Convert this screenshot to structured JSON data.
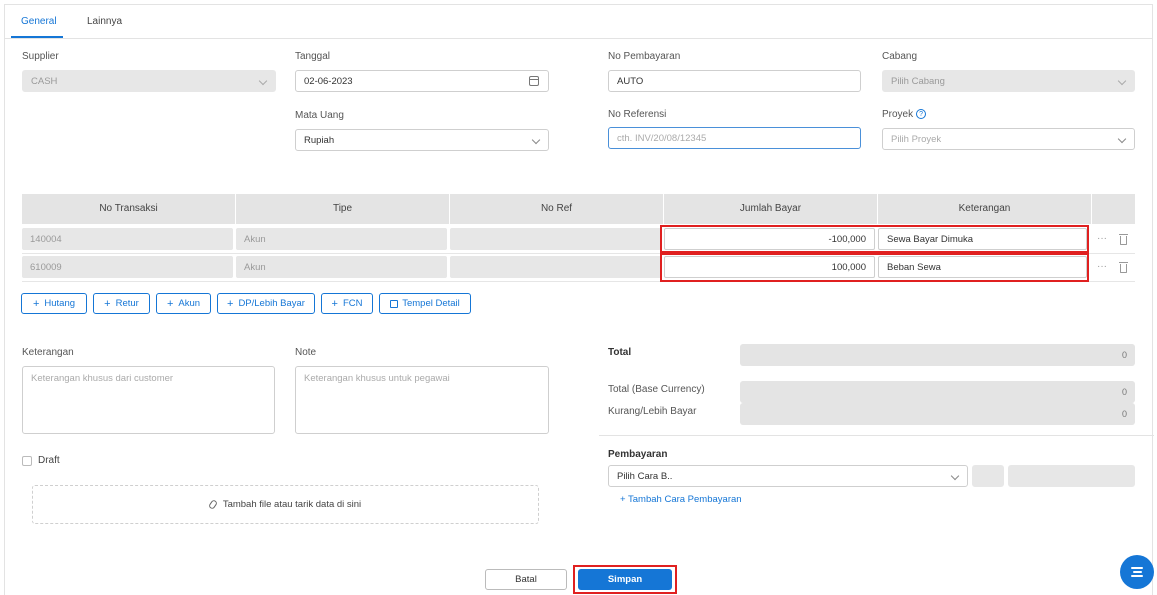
{
  "tabs": [
    {
      "label": "General",
      "active": true
    },
    {
      "label": "Lainnya",
      "active": false
    }
  ],
  "form": {
    "supplier": {
      "label": "Supplier",
      "value": "CASH"
    },
    "tanggal": {
      "label": "Tanggal",
      "value": "02-06-2023"
    },
    "no_pembayaran": {
      "label": "No Pembayaran",
      "value": "AUTO"
    },
    "cabang": {
      "label": "Cabang",
      "placeholder": "Pilih Cabang"
    },
    "mata_uang": {
      "label": "Mata Uang",
      "value": "Rupiah"
    },
    "no_referensi": {
      "label": "No Referensi",
      "placeholder": "cth. INV/20/08/12345"
    },
    "proyek": {
      "label": "Proyek",
      "help": "?",
      "placeholder": "Pilih Proyek"
    }
  },
  "table": {
    "headers": [
      "No Transaksi",
      "Tipe",
      "No Ref",
      "Jumlah Bayar",
      "Keterangan"
    ],
    "rows": [
      {
        "no_transaksi": "140004",
        "tipe": "Akun",
        "no_ref": "",
        "jumlah_bayar": "-100,000",
        "keterangan": "Sewa Bayar Dimuka",
        "more": "···"
      },
      {
        "no_transaksi": "610009",
        "tipe": "Akun",
        "no_ref": "",
        "jumlah_bayar": "100,000",
        "keterangan": "Beban Sewa",
        "more": "···"
      }
    ]
  },
  "add_buttons": [
    {
      "icon": "+",
      "label": "Hutang"
    },
    {
      "icon": "+",
      "label": "Retur"
    },
    {
      "icon": "+",
      "label": "Akun"
    },
    {
      "icon": "+",
      "label": "DP/Lebih Bayar"
    },
    {
      "icon": "+",
      "label": "FCN"
    },
    {
      "icon": "copy-icon",
      "label": "Tempel Detail"
    }
  ],
  "keterangan": {
    "label": "Keterangan",
    "placeholder": "Keterangan khusus dari customer"
  },
  "note": {
    "label": "Note",
    "placeholder": "Keterangan khusus untuk pegawai"
  },
  "totals": {
    "total_label": "Total",
    "total_value": "0",
    "base_label": "Total (Base Currency)",
    "base_value": "0",
    "kurang_label": "Kurang/Lebih Bayar",
    "kurang_value": "0"
  },
  "draft": {
    "label": "Draft",
    "checked": false
  },
  "dropzone": {
    "label": "Tambah file atau tarik data di sini"
  },
  "pembayaran": {
    "label": "Pembayaran",
    "select_value": "Pilih Cara B..",
    "add_link": "+ Tambah Cara Pembayaran"
  },
  "actions": {
    "cancel": "Batal",
    "save": "Simpan"
  },
  "colors": {
    "accent": "#1576d6",
    "highlight": "#e02020",
    "disabled_bg": "#e7e7e7"
  }
}
